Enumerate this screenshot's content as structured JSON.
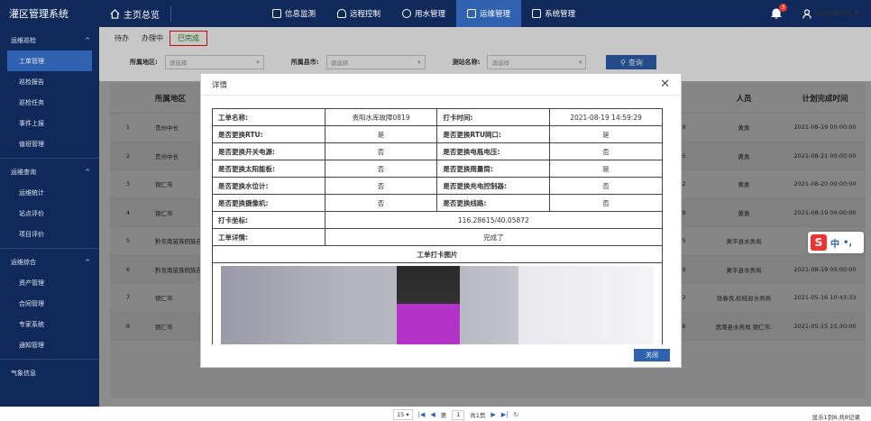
{
  "app": {
    "title": "灌区管理系统",
    "home_label": "主页总览"
  },
  "nav": [
    {
      "label": "信息监测",
      "active": false
    },
    {
      "label": "远程控制",
      "active": false
    },
    {
      "label": "用水管理",
      "active": false
    },
    {
      "label": "运维管理",
      "active": true
    },
    {
      "label": "系统管理",
      "active": false
    }
  ],
  "notifications": {
    "count": "3"
  },
  "user": {
    "name": "sysywmg"
  },
  "sidebar": {
    "sections": [
      {
        "label": "运维巡检",
        "items": [
          "工单管理",
          "巡检报告",
          "巡检任务",
          "事件上报",
          "值班管理"
        ]
      },
      {
        "label": "运维查询",
        "items": [
          "运维统计",
          "站点评价",
          "项目评价"
        ]
      },
      {
        "label": "运维综合",
        "items": [
          "资产管理",
          "合同管理",
          "专家系统",
          "通知管理"
        ]
      }
    ],
    "extra": "气象信息",
    "active_item": "工单管理"
  },
  "tabs": [
    {
      "label": "待办"
    },
    {
      "label": "办理中"
    },
    {
      "label": "已完成"
    }
  ],
  "filters": {
    "region_label": "所属地区:",
    "city_label": "所属县市:",
    "station_label": "测站名称:",
    "placeholder": "请选择",
    "query_label": "查询"
  },
  "table": {
    "headers": {
      "region": "所属地区",
      "person": "人员",
      "plan": "计划完成时间"
    },
    "rows": [
      {
        "idx": "1",
        "region": "贵州中长",
        "time": "5:29",
        "person": "黄勇",
        "plan": "2021-08-19 00:00:00"
      },
      {
        "idx": "2",
        "region": "贵州中长",
        "time": "4:45",
        "person": "黄勇",
        "plan": "2021-08-21 00:00:00"
      },
      {
        "idx": "3",
        "region": "铜仁市",
        "time": "3:52",
        "person": "黄勇",
        "plan": "2021-08-20 00:00:00"
      },
      {
        "idx": "4",
        "region": "铜仁市",
        "time": "1:39",
        "person": "黄勇",
        "plan": "2021-08-19 00:00:00"
      },
      {
        "idx": "5",
        "region": "黔东南苗族侗族自",
        "time": "0:55",
        "person": "黄平县水务局",
        "plan": "2021"
      },
      {
        "idx": "6",
        "region": "黔东南苗族侗族自",
        "time": "3:59",
        "person": "黄平县水务局",
        "plan": "2021-08-19 00:00:00"
      },
      {
        "idx": "7",
        "region": "铜仁市",
        "time": "8:02",
        "person": "张春良,松桃县水务局",
        "plan": "2021-05-16 10:43:33"
      },
      {
        "idx": "8",
        "region": "铜仁市",
        "time": "5:46",
        "person": "思南县水务局 铜仁市.",
        "plan": "2021-05-15 15:30:00"
      }
    ]
  },
  "pager": {
    "page_size": "15",
    "page_prefix": "第",
    "page": "1",
    "total_pages": "共1页",
    "info": "显示1到8,共8记录"
  },
  "modal": {
    "title": "详情",
    "fields": [
      {
        "k1": "工单名称:",
        "v1": "贵阳水库故障0819",
        "k2": "打卡时间:",
        "v2": "2021-08-19 14:59:29"
      },
      {
        "k1": "是否更换RTU:",
        "v1": "是",
        "k2": "是否更换RTU网口:",
        "v2": "是"
      },
      {
        "k1": "是否更换开关电源:",
        "v1": "否",
        "k2": "是否更换电瓶电压:",
        "v2": "否"
      },
      {
        "k1": "是否更换太阳能板:",
        "v1": "否",
        "k2": "是否更换雨量筒:",
        "v2": "是"
      },
      {
        "k1": "是否更换水位计:",
        "v1": "否",
        "k2": "是否更换充电控制器:",
        "v2": "否"
      },
      {
        "k1": "是否更换摄像机:",
        "v1": "否",
        "k2": "是否更换线路:",
        "v2": "否"
      }
    ],
    "coord_label": "打卡坐标:",
    "coord_value": "116.28615/40.05872",
    "detail_label": "工单详情:",
    "detail_value": "完成了",
    "photo_title": "工单打卡图片",
    "close_label": "关闭"
  },
  "ime": {
    "glyph": "S",
    "text": "中"
  }
}
